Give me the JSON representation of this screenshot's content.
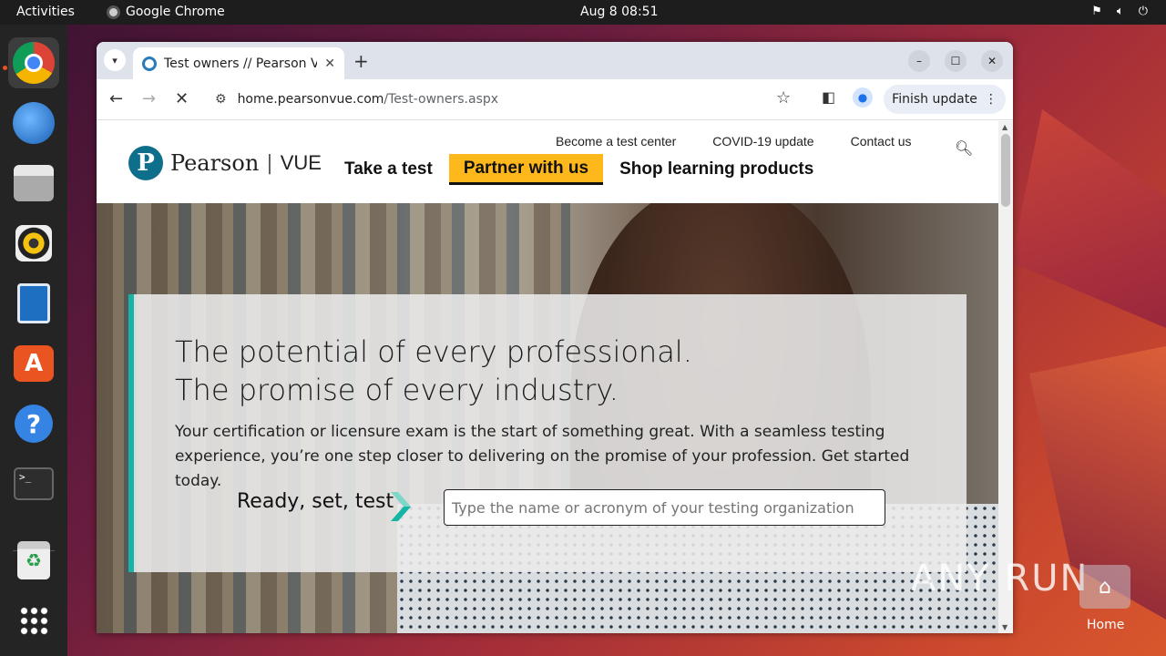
{
  "topbar": {
    "activities": "Activities",
    "app": "Google Chrome",
    "clock": "Aug 8  08:51"
  },
  "browser": {
    "tab_title": "Test owners // Pearson V",
    "url_host": "home.pearsonvue.com",
    "url_path": "/Test-owners.aspx",
    "update_label": "Finish update"
  },
  "site": {
    "brand": "Pearson",
    "brand_suffix": "VUE",
    "util_links": [
      "Become a test center",
      "COVID-19 update",
      "Contact us"
    ],
    "nav": [
      "Take a test",
      "Partner with us",
      "Shop learning products"
    ],
    "hero_line1": "The potential of every professional.",
    "hero_line2": "The promise of every industry.",
    "hero_body": "Your certification or licensure exam is the start of something great. With a seamless testing experience, you’re one step closer to delivering on the promise of your profession. Get started today.",
    "ready_label": "Ready, set, test",
    "search_placeholder": "Type the name or acronym of your testing organization"
  },
  "desktop": {
    "watermark": "ANY RUN",
    "home_label": "Home"
  },
  "colors": {
    "accent_teal": "#15b5a6",
    "nav_highlight": "#ffb81c",
    "logo_blue": "#0d6f8b"
  },
  "icons": [
    "chrome-icon",
    "thunderbird-icon",
    "files-icon",
    "rhythmbox-icon",
    "writer-icon",
    "app-center-icon",
    "help-icon",
    "terminal-icon",
    "trash-icon",
    "app-grid-icon"
  ]
}
